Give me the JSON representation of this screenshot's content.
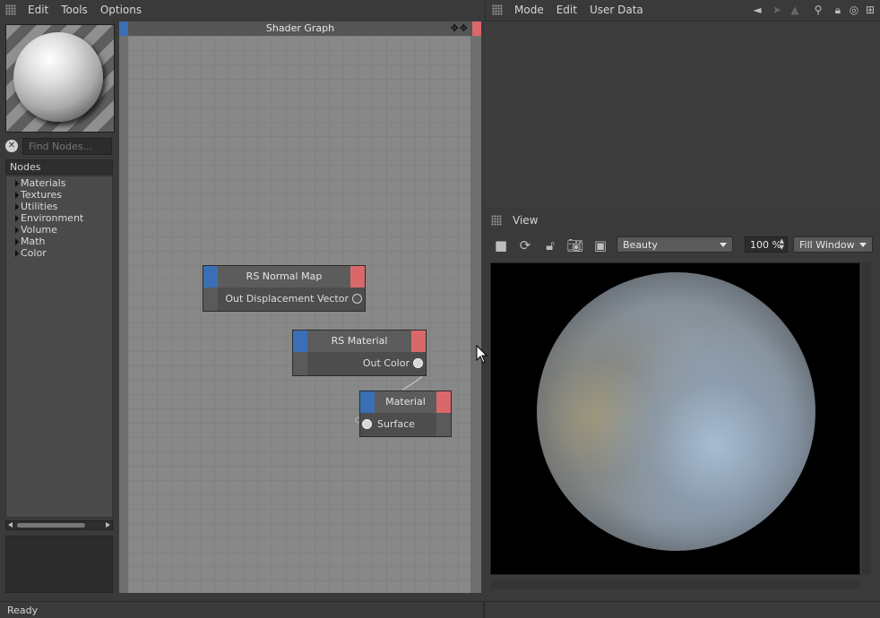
{
  "left_menu": {
    "items": [
      {
        "label": "Edit"
      },
      {
        "label": "Tools"
      },
      {
        "label": "Options"
      }
    ]
  },
  "find_nodes": {
    "placeholder": "Find Nodes..."
  },
  "nodes_panel": {
    "header": "Nodes",
    "items": [
      {
        "label": "Materials"
      },
      {
        "label": "Textures"
      },
      {
        "label": "Utilities"
      },
      {
        "label": "Environment"
      },
      {
        "label": "Volume"
      },
      {
        "label": "Math"
      },
      {
        "label": "Color"
      }
    ]
  },
  "shader_graph": {
    "title": "Shader Graph",
    "nodes": [
      {
        "title": "RS Normal Map",
        "port": "Out Displacement Vector"
      },
      {
        "title": "RS Material",
        "port": "Out Color"
      },
      {
        "title": "Material",
        "port": "Surface"
      }
    ]
  },
  "right_menu": {
    "items": [
      {
        "label": "Mode"
      },
      {
        "label": "Edit"
      },
      {
        "label": "User Data"
      }
    ]
  },
  "view": {
    "title": "View",
    "aov": "Beauty",
    "zoom": "100 %",
    "fit": "Fill Window"
  },
  "status": {
    "text": "Ready"
  },
  "colors": {
    "port_in_blue": "#3a6fb5",
    "port_out_red": "#d9686a"
  }
}
